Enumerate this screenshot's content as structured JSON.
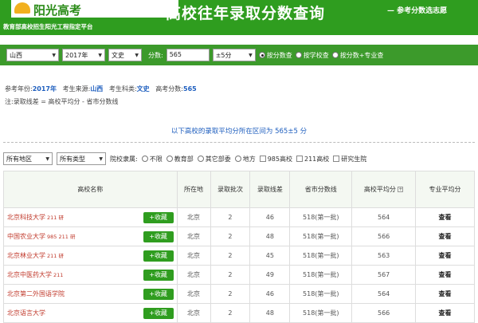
{
  "header": {
    "logo_text": "阳光高考",
    "subline": "教育部高校招生阳光工程指定平台",
    "title": "高校往年录取分数查询",
    "tagline": "— 参考分数选志愿"
  },
  "search": {
    "province": "山西",
    "year": "2017年",
    "category": "文史",
    "score_label": "分数:",
    "score_value": "565",
    "range": "±5分",
    "options": [
      "按分数查",
      "按学校查",
      "按分数+专业查"
    ],
    "selected_option": "按分数查"
  },
  "info": {
    "year_label": "参考年份:",
    "year_value": "2017年",
    "origin_label": "考生来源:",
    "origin_value": "山西",
    "subject_label": "考生科类:",
    "subject_value": "文史",
    "score_label": "高考分数:",
    "score_value": "565",
    "note": "注:录取线差 = 高校平均分 - 省市分数线"
  },
  "summary": "以下高校的录取平均分所在区间为 565±5 分",
  "filters": {
    "region": "所有地区",
    "type": "所有类型",
    "affiliation_label": "院校隶属:",
    "affiliations": [
      "不限",
      "教育部",
      "其它部委",
      "地方"
    ],
    "checkboxes": [
      "985高校",
      "211高校",
      "研究生院"
    ]
  },
  "table": {
    "headers": [
      "高校名称",
      "所在地",
      "录取批次",
      "录取线差",
      "省市分数线",
      "高校平均分",
      "专业平均分"
    ],
    "fav_label": "+收藏",
    "view_label": "查看",
    "rows": [
      {
        "name": "北京科技大学",
        "tags": "211 研",
        "city": "北京",
        "batch": "2",
        "gap": "46",
        "line": "518(第一批)",
        "avg": "564"
      },
      {
        "name": "中国农业大学",
        "tags": "985 211 研",
        "city": "北京",
        "batch": "2",
        "gap": "48",
        "line": "518(第一批)",
        "avg": "566"
      },
      {
        "name": "北京林业大学",
        "tags": "211 研",
        "city": "北京",
        "batch": "2",
        "gap": "45",
        "line": "518(第一批)",
        "avg": "563"
      },
      {
        "name": "北京中医药大学",
        "tags": "211",
        "city": "北京",
        "batch": "2",
        "gap": "49",
        "line": "518(第一批)",
        "avg": "567"
      },
      {
        "name": "北京第二外国语学院",
        "tags": "",
        "city": "北京",
        "batch": "2",
        "gap": "46",
        "line": "518(第一批)",
        "avg": "564"
      },
      {
        "name": "北京语言大学",
        "tags": "",
        "city": "北京",
        "batch": "2",
        "gap": "48",
        "line": "518(第一批)",
        "avg": "566"
      }
    ]
  }
}
